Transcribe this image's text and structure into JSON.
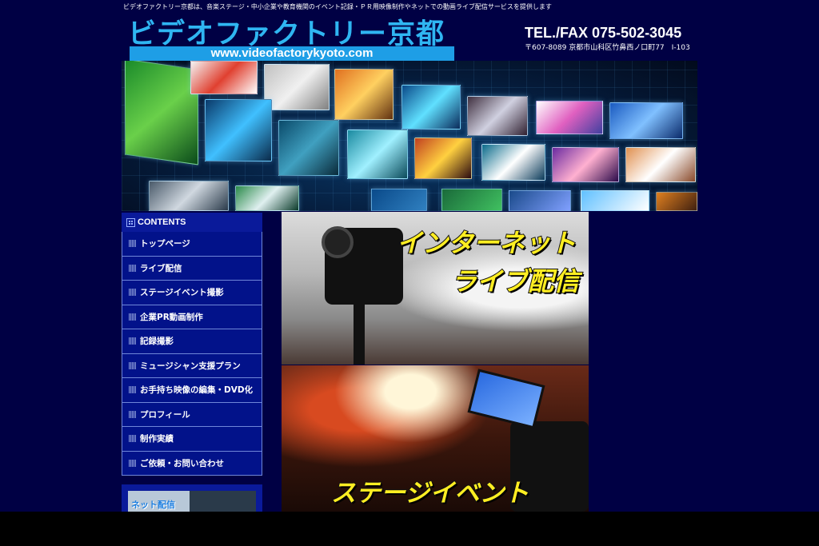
{
  "header": {
    "tagline": "ビデオファクトリー京都は、音楽ステージ・中小企業や教育機関のイベント記録・ＰＲ用映像制作やネットでの動画ライブ配信サービスを提供します",
    "logo_text": "ビデオファクトリー京都",
    "url": "www.videofactorykyoto.com",
    "tel": "TEL./FAX 075-502-3045",
    "address": "〒607-8089 京都市山科区竹鼻西ノ口町77　Ⅰ-103"
  },
  "sidebar": {
    "heading": "CONTENTS",
    "items": [
      {
        "label": "トップページ"
      },
      {
        "label": "ライブ配信"
      },
      {
        "label": "ステージイベント撮影"
      },
      {
        "label": "企業PR動画制作"
      },
      {
        "label": "記録撮影"
      },
      {
        "label": "ミュージシャン支援プラン"
      },
      {
        "label": "お手持ち映像の編集・DVD化"
      },
      {
        "label": "プロフィール"
      },
      {
        "label": "制作実績"
      },
      {
        "label": "ご依頼・お問い合わせ"
      }
    ],
    "banner_text": "ネット配信"
  },
  "features": {
    "live_line1": "インターネット",
    "live_line2": "ライブ配信",
    "stage_title": "ステージイベント"
  },
  "colors": {
    "page_bg": "#000044",
    "logo_blue": "#2fb6f2",
    "nav_bg": "#02128a",
    "feature_text": "#ffee22"
  }
}
